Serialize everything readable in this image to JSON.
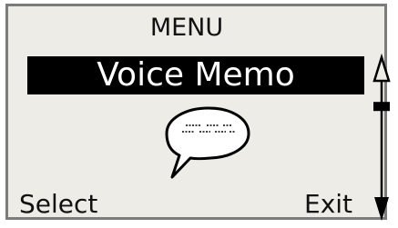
{
  "screen": {
    "title": "MENU",
    "selected_item": "Voice Memo",
    "item_icon": "speech-bubble-icon"
  },
  "softkeys": {
    "left": "Select",
    "right": "Exit"
  },
  "scroll": {
    "up_icon": "scroll-up-arrow-icon",
    "down_icon": "scroll-down-arrow-icon",
    "position_fraction": 0.2
  },
  "colors": {
    "screen_background": "#eeece6",
    "text": "#111111",
    "highlight_background": "#000000",
    "highlight_text": "#ffffff"
  }
}
